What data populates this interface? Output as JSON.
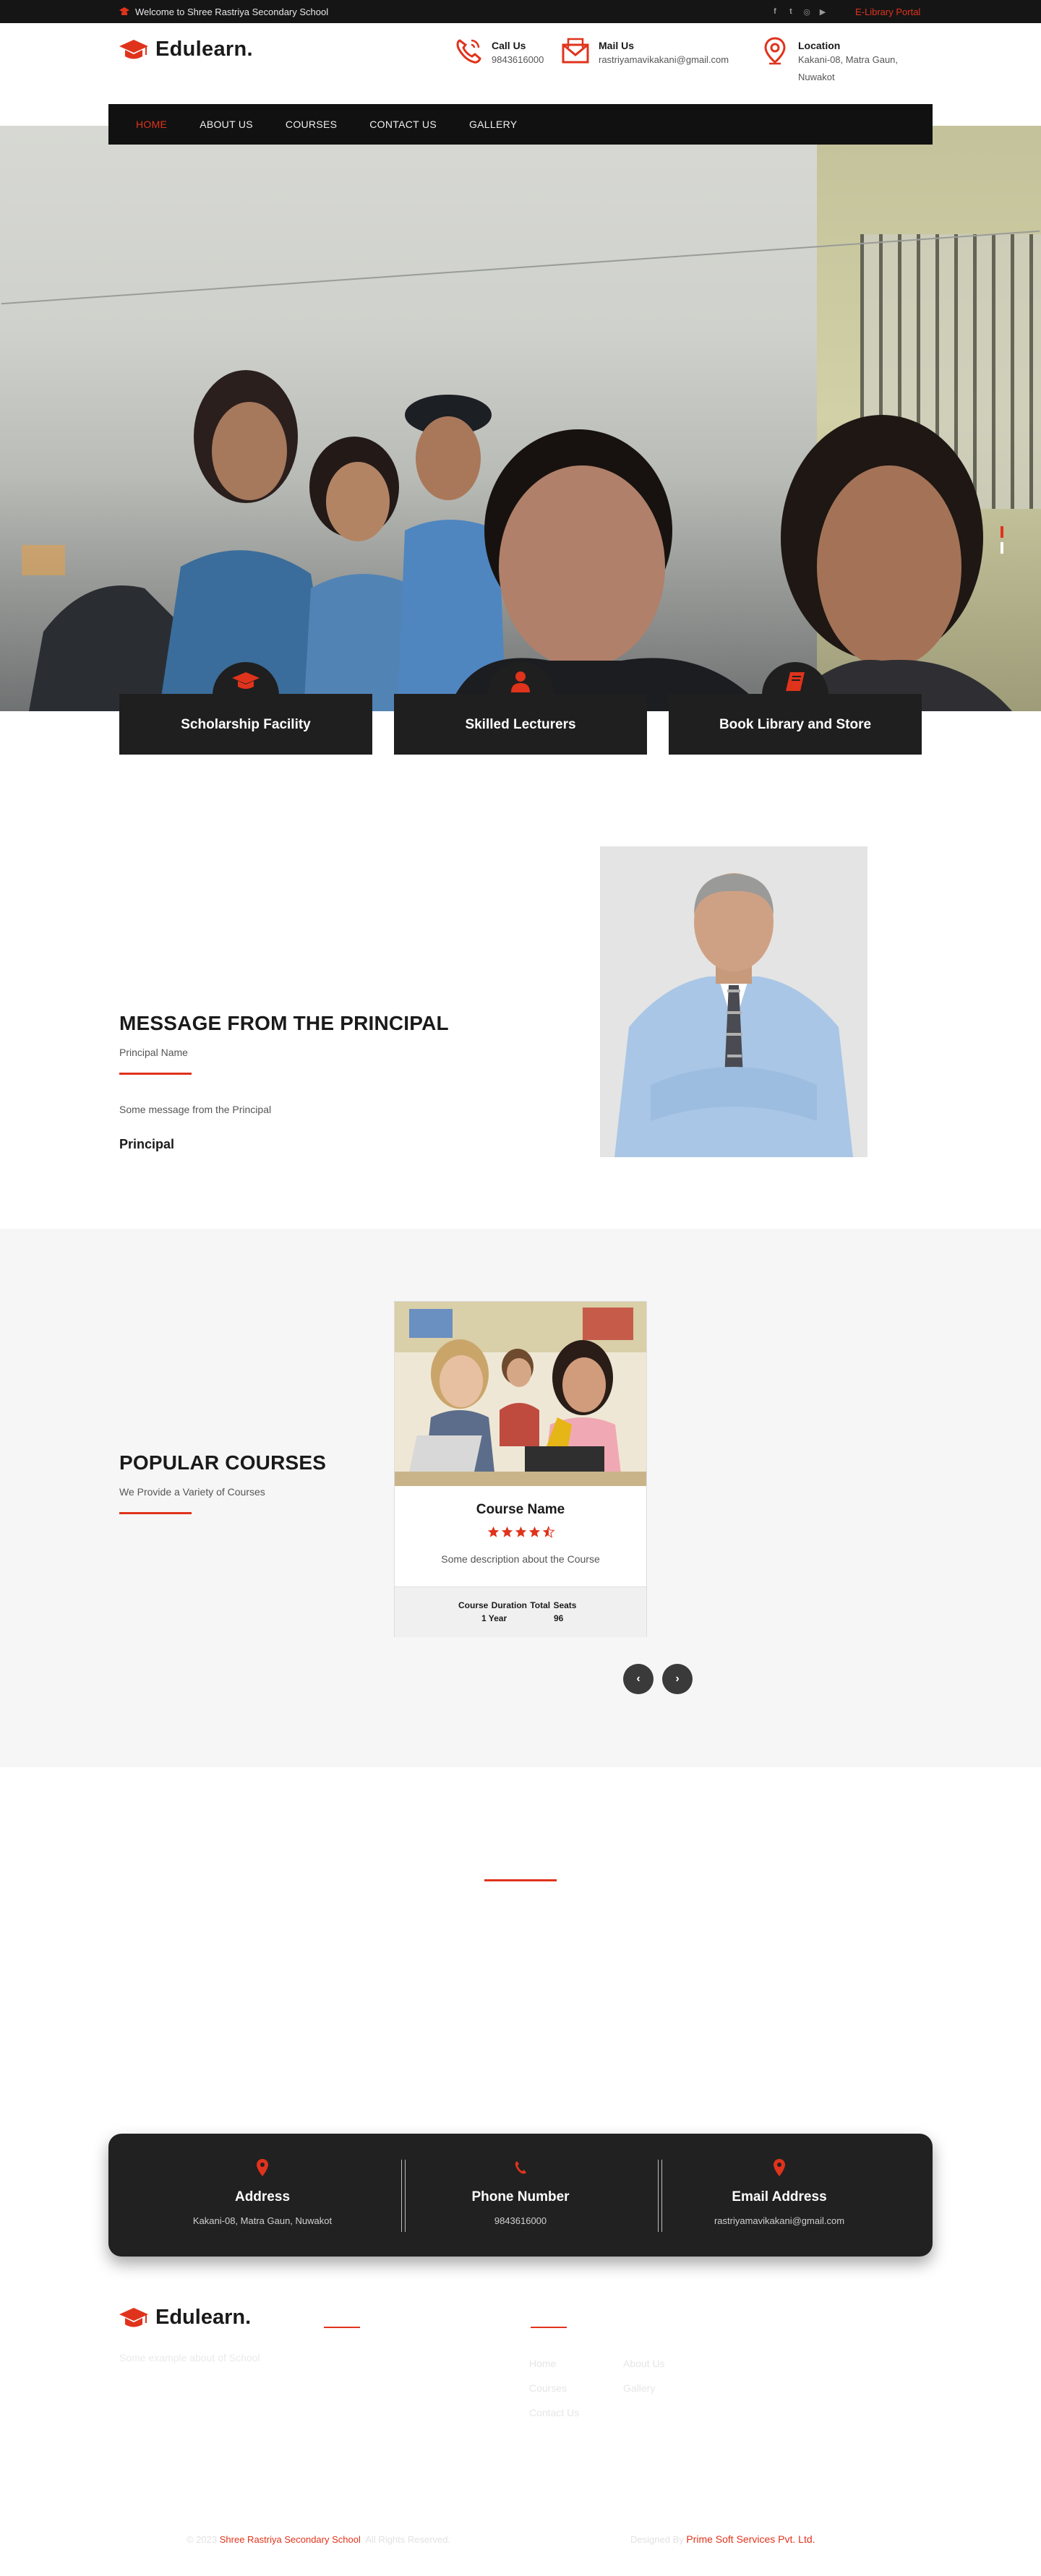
{
  "topbar": {
    "welcome": "Welcome to Shree Rastriya Secondary School",
    "elibrary": "E-Library Portal",
    "socials": [
      "facebook-icon",
      "twitter-icon",
      "instagram-icon",
      "youtube-icon"
    ]
  },
  "brand": {
    "name": "Edulearn."
  },
  "header": {
    "call": {
      "title": "Call Us",
      "value": "9843616000",
      "icon": "phone-icon"
    },
    "mail": {
      "title": "Mail Us",
      "value": "rastriyamavikakani@gmail.com",
      "icon": "mail-icon"
    },
    "location": {
      "title": "Location",
      "value": "Kakani-08, Matra Gaun, Nuwakot",
      "icon": "location-pin-icon"
    }
  },
  "nav": {
    "items": [
      {
        "label": "HOME",
        "active": true
      },
      {
        "label": "ABOUT US",
        "active": false
      },
      {
        "label": "COURSES",
        "active": false
      },
      {
        "label": "CONTACT US",
        "active": false
      },
      {
        "label": "GALLERY",
        "active": false
      }
    ]
  },
  "features": [
    {
      "title": "Scholarship Facility",
      "icon": "graduation-cap-icon"
    },
    {
      "title": "Skilled Lecturers",
      "icon": "user-icon"
    },
    {
      "title": "Book Library and Store",
      "icon": "book-icon"
    }
  ],
  "principal": {
    "heading": "MESSAGE FROM THE PRINCIPAL",
    "name": "Principal Name",
    "message": "Some message from the Principal",
    "role": "Principal"
  },
  "courses": {
    "heading": "POPULAR COURSES",
    "subheading": "We Provide a Variety of Courses",
    "card": {
      "name": "Course Name",
      "rating": 4.5,
      "description": "Some description about the Course",
      "meta_header": "Course Duration Total Seats",
      "duration": "1 Year",
      "seats": "96"
    },
    "prev": "‹",
    "next": "›"
  },
  "contact": {
    "address": {
      "title": "Address",
      "value": "Kakani-08, Matra Gaun, Nuwakot"
    },
    "phone": {
      "title": "Phone Number",
      "value": "9843616000"
    },
    "email": {
      "title": "Email Address",
      "value": "rastriyamavikakani@gmail.com"
    }
  },
  "footer": {
    "about": "Some example about of School",
    "links_col1": [
      "Home",
      "Courses",
      "Contact Us"
    ],
    "links_col2": [
      "About Us",
      "Gallery"
    ],
    "copyright_prefix": "© 2023",
    "copyright_school": "Shree Rastriya Secondary School",
    "copyright_suffix": ". All Rights Reserved.",
    "designed_prefix": "Designed By",
    "designed_company": "Prime Soft Services Pvt. Ltd."
  },
  "colors": {
    "accent": "#e0331c",
    "dark": "#1f1f1f",
    "topbar": "#151515"
  }
}
